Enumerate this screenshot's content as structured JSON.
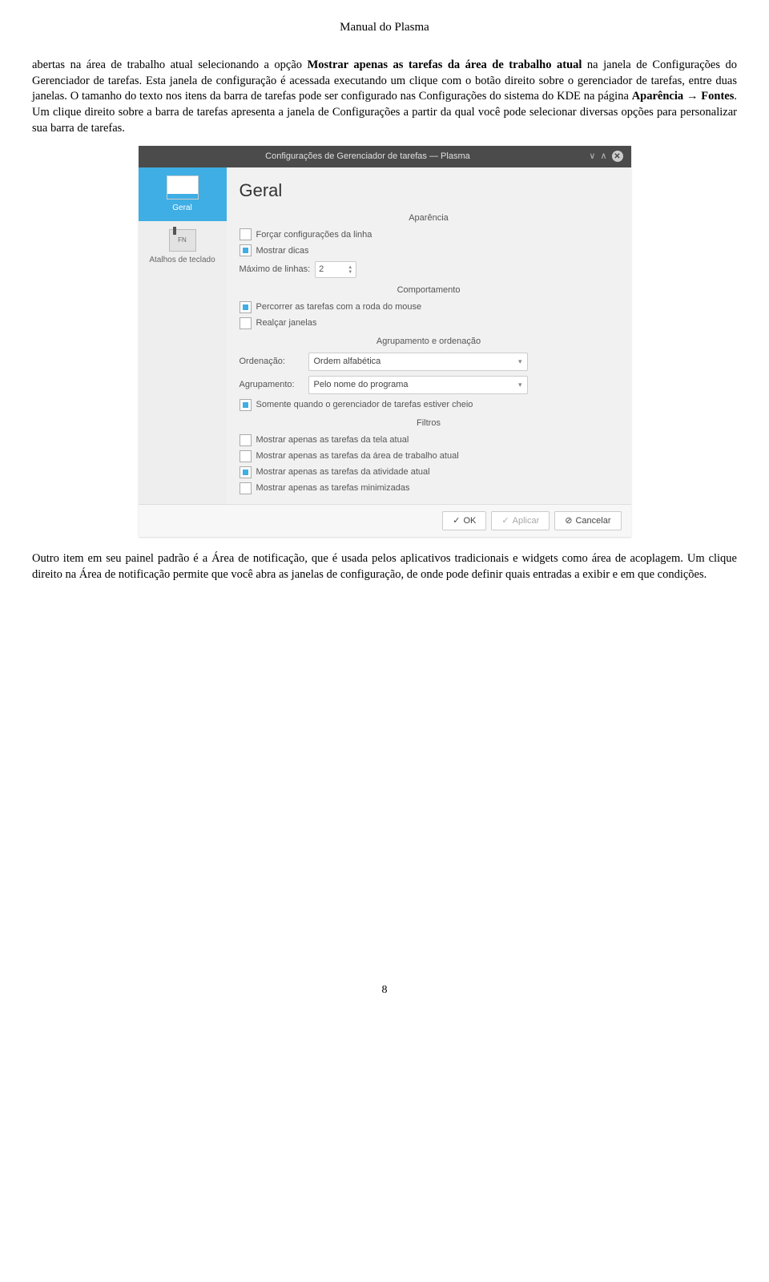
{
  "doc": {
    "title": "Manual do Plasma",
    "para1a": "abertas na área de trabalho atual selecionando a opção ",
    "para1b": "Mostrar apenas as tarefas da área de trabalho atual",
    "para1c": " na janela de Configurações do Gerenciador de tarefas. Esta janela de configuração é acessada executando um clique com o botão direito sobre o gerenciador de tarefas, entre duas janelas. O tamanho do texto nos itens da barra de tarefas pode ser configurado nas Configurações do sistema do KDE na página ",
    "para1d": "Aparência",
    "para1e": " → ",
    "para1f": "Fontes",
    "para1g": ". Um clique direito sobre a barra de tarefas apresenta a janela de Configurações a partir da qual você pode selecionar diversas opções para personalizar sua barra de tarefas.",
    "para2": "Outro item em seu painel padrão é a Área de notificação, que é usada pelos aplicativos tradicionais e widgets como área de acoplagem. Um clique direito na Área de notificação permite que você abra as janelas de configuração, de onde pode definir quais entradas a exibir e em que condições.",
    "page_number": "8"
  },
  "dialog": {
    "title": "Configurações de Gerenciador de tarefas — Plasma",
    "sidebar": {
      "item1": "Geral",
      "item2": "Atalhos de teclado",
      "item2_fn": "FN"
    },
    "main_title": "Geral",
    "sections": {
      "appearance": "Aparência",
      "behavior": "Comportamento",
      "grouping": "Agrupamento e ordenação",
      "filters": "Filtros"
    },
    "appearance": {
      "force_line": "Forçar configurações da linha",
      "tooltips": "Mostrar dicas",
      "max_lines_label": "Máximo de linhas:",
      "max_lines_value": "2"
    },
    "behavior": {
      "wheel": "Percorrer as tarefas com a roda do mouse",
      "highlight": "Realçar janelas"
    },
    "grouping": {
      "sort_label": "Ordenação:",
      "sort_value": "Ordem alfabética",
      "group_label": "Agrupamento:",
      "group_value": "Pelo nome do programa",
      "only_when_full": "Somente quando o gerenciador de tarefas estiver cheio"
    },
    "filters": {
      "screen": "Mostrar apenas as tarefas da tela atual",
      "desktop": "Mostrar apenas as tarefas da área de trabalho atual",
      "activity": "Mostrar apenas as tarefas da atividade atual",
      "minimized": "Mostrar apenas as tarefas minimizadas"
    },
    "buttons": {
      "ok": "OK",
      "apply": "Aplicar",
      "cancel": "Cancelar"
    }
  }
}
